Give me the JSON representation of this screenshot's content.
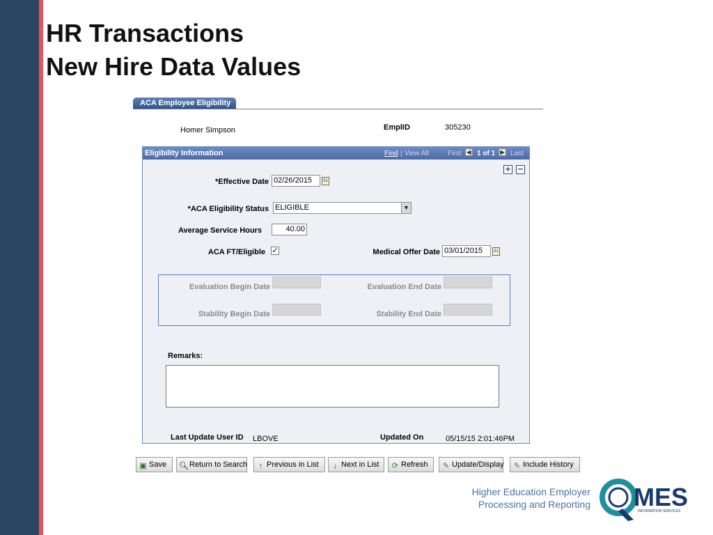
{
  "slide": {
    "title_line1": "HR Transactions",
    "title_line2": "New Hire Data Values"
  },
  "page": {
    "tab_label": "ACA Employee Eligibility",
    "employee_name": "Homer Simpson",
    "emplid_label": "EmplID",
    "emplid_value": "305230"
  },
  "panel": {
    "title": "Eligibility Information",
    "nav": {
      "find": "Find",
      "separator": "|",
      "view_all": "View All",
      "first": "First",
      "count": "1 of 1",
      "last": "Last"
    },
    "add_row": "+",
    "delete_row": "−",
    "effective_date_label": "*Effective Date",
    "effective_date_value": "02/26/2015",
    "eligibility_status_label": "*ACA Eligibility Status",
    "eligibility_status_value": "ELIGIBLE",
    "avg_service_hours_label": "Average Service Hours",
    "avg_service_hours_value": "40.00",
    "ft_eligible_label": "ACA FT/Eligible",
    "ft_eligible_checked": true,
    "medical_offer_date_label": "Medical Offer Date",
    "medical_offer_date_value": "03/01/2015",
    "evaluation_begin_label": "Evaluation Begin Date",
    "evaluation_end_label": "Evaluation End Date",
    "stability_begin_label": "Stability Begin Date",
    "stability_end_label": "Stability End Date",
    "remarks_label": "Remarks:",
    "remarks_value": "",
    "last_update_label": "Last Update User ID",
    "last_update_value": "LBOVE",
    "updated_on_label": "Updated On",
    "updated_on_value": "05/15/15  2:01:46PM"
  },
  "toolbar": {
    "save": "Save",
    "return_to_search": "Return to Search",
    "previous_in_list": "Previous in List",
    "next_in_list": "Next in List",
    "refresh": "Refresh",
    "update_display": "Update/Display",
    "include_history": "Include History"
  },
  "footer": {
    "line1": "Higher Education Employer",
    "line2": "Processing and Reporting",
    "logo_text": "MES",
    "logo_subtext": "INFORMATION SERVICES"
  },
  "colors": {
    "side_bar": "#2b4563",
    "side_stripe": "#e0585a",
    "panel_header": "#4a6aa8",
    "footer_text": "#4a72a8",
    "logo_teal": "#1f8fa0",
    "logo_navy": "#163a6b"
  }
}
